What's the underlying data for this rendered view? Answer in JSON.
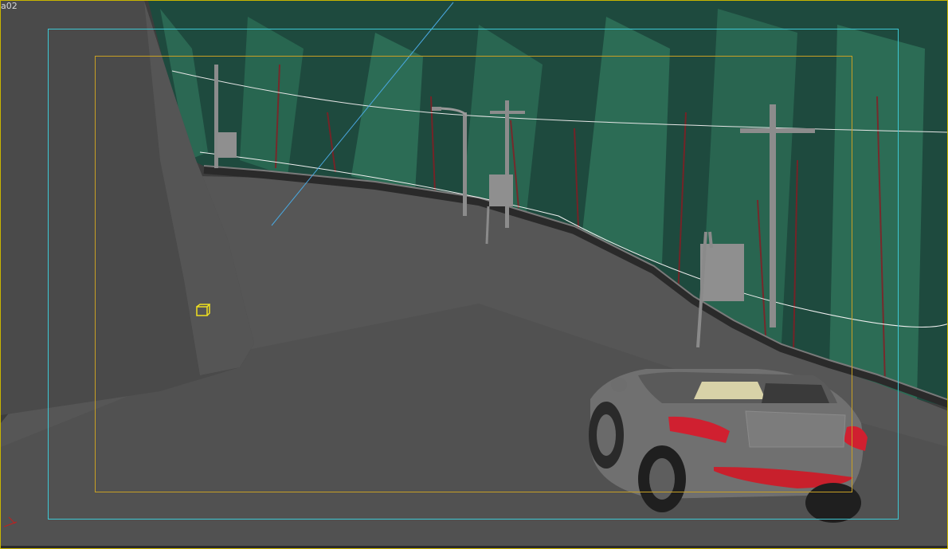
{
  "viewport": {
    "label": "a02",
    "frame_color": "#c8b400",
    "safe_frame_outer_color": "#3ec8d4",
    "safe_frame_inner_color": "#c8a024",
    "background_color": "#3b3b3b",
    "camera_target_icon": "camera-target-icon"
  }
}
